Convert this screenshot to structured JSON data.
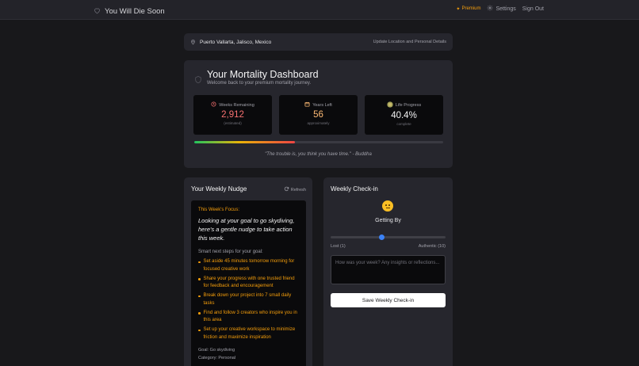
{
  "header": {
    "app_title": "You Will Die Soon",
    "premium_label": "Premium",
    "settings_label": "Settings",
    "signout_label": "Sign Out"
  },
  "location": {
    "text": "Puerto Vallarta, Jalisco, Mexico",
    "update_link": "Update Location and Personal Details"
  },
  "dashboard": {
    "title": "Your Mortality Dashboard",
    "subtitle": "Welcome back to your premium mortality journey.",
    "stats": [
      {
        "label": "Weeks Remaining",
        "value": "2,912",
        "note": "(estimated)",
        "color": "#f87171",
        "icon": "clock-icon"
      },
      {
        "label": "Years Left",
        "value": "56",
        "note": "approximately",
        "color": "#fdba74",
        "icon": "calendar-icon"
      },
      {
        "label": "Life Progress",
        "value": "40.4%",
        "note": "complete",
        "color": "#f4f4f5",
        "icon": "progress-circle-icon"
      }
    ],
    "progress_fraction": 0.404,
    "quote": "\"The trouble is, you think you have time.\" - Buddha"
  },
  "nudge": {
    "title": "Your Weekly Nudge",
    "refresh_label": "Refresh",
    "focus_label": "This Week's Focus:",
    "focus_text": "Looking at your goal to go skydiving, here's a gentle nudge to take action this week.",
    "steps_title": "Smart next steps for your goal:",
    "steps": [
      "Set aside 45 minutes tomorrow morning for focused creative work",
      "Share your progress with one trusted friend for feedback and encouragement",
      "Break down your project into 7 small daily tasks",
      "Find and follow 3 creators who inspire you in this area",
      "Set up your creative workspace to minimize friction and maximize inspiration"
    ],
    "goal": "Goal: Go skydiving",
    "category": "Category: Personal"
  },
  "checkin": {
    "title": "Weekly Check-in",
    "mood_emoji": "neutral-face-icon",
    "mood_label": "Getting By",
    "slider_value": 5,
    "slider_min": 1,
    "slider_max": 10,
    "min_label": "Lost (1)",
    "max_label": "Authentic (10)",
    "reflection_placeholder": "How was your week? Any insights or reflections...",
    "save_label": "Save Weekly Check-in"
  },
  "colors": {
    "background": "#18181b",
    "card": "#26262d",
    "accent_amber": "#f59e0b",
    "slider_blue": "#3b82f6"
  }
}
